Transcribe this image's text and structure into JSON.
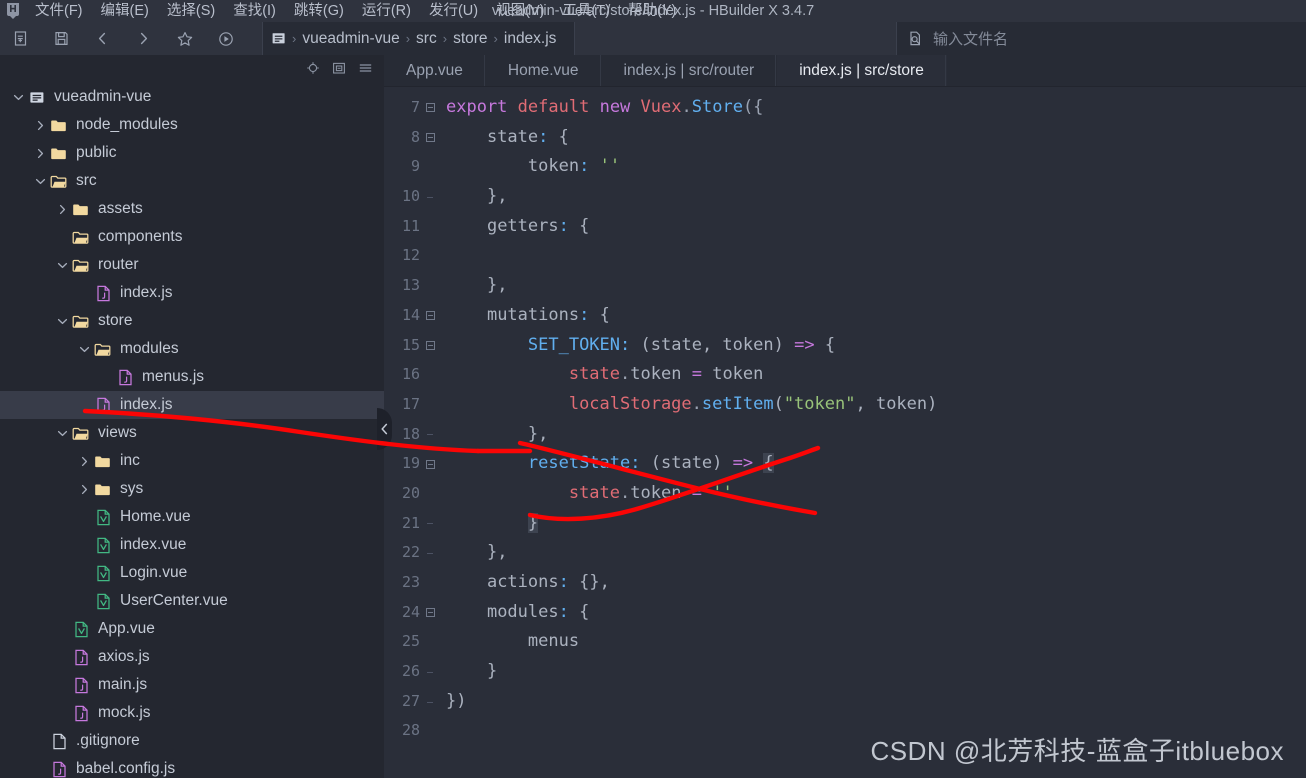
{
  "window": {
    "title": "vueadmin-vue/src/store/index.js - HBuilder X 3.4.7",
    "app_icon": "hbuilder-logo-icon"
  },
  "menubar": {
    "items": [
      {
        "label": "文件(F)"
      },
      {
        "label": "编辑(E)"
      },
      {
        "label": "选择(S)"
      },
      {
        "label": "查找(I)"
      },
      {
        "label": "跳转(G)"
      },
      {
        "label": "运行(R)"
      },
      {
        "label": "发行(U)"
      },
      {
        "label": "视图(V)"
      },
      {
        "label": "工具(T)"
      },
      {
        "label": "帮助(Y)"
      }
    ]
  },
  "toolbar": {
    "buttons": [
      {
        "name": "new-file-icon"
      },
      {
        "name": "save-icon"
      },
      {
        "name": "back-icon"
      },
      {
        "name": "forward-icon"
      },
      {
        "name": "favorite-star-icon"
      },
      {
        "name": "run-icon"
      }
    ]
  },
  "breadcrumb": {
    "icon": "project-folder-icon",
    "items": [
      "vueadmin-vue",
      "src",
      "store",
      "index.js"
    ],
    "separator": "›"
  },
  "filename_search": {
    "icon": "file-search-icon",
    "placeholder": "输入文件名",
    "value": ""
  },
  "sidebar": {
    "header_buttons": [
      {
        "name": "locate-file-icon"
      },
      {
        "name": "collapse-all-icon"
      },
      {
        "name": "sidebar-menu-icon"
      }
    ],
    "tree": [
      {
        "label": "vueadmin-vue",
        "depth": 0,
        "icon": "project-icon",
        "twisty": "down",
        "selected": false
      },
      {
        "label": "node_modules",
        "depth": 1,
        "icon": "folder-closed",
        "twisty": "right",
        "selected": false
      },
      {
        "label": "public",
        "depth": 1,
        "icon": "folder-closed",
        "twisty": "right",
        "selected": false
      },
      {
        "label": "src",
        "depth": 1,
        "icon": "folder-open",
        "twisty": "down",
        "selected": false
      },
      {
        "label": "assets",
        "depth": 2,
        "icon": "folder-closed",
        "twisty": "right",
        "selected": false
      },
      {
        "label": "components",
        "depth": 2,
        "icon": "folder-open",
        "twisty": "none",
        "selected": false
      },
      {
        "label": "router",
        "depth": 2,
        "icon": "folder-open",
        "twisty": "down",
        "selected": false
      },
      {
        "label": "index.js",
        "depth": 3,
        "icon": "js-file",
        "twisty": "none",
        "selected": false
      },
      {
        "label": "store",
        "depth": 2,
        "icon": "folder-open",
        "twisty": "down",
        "selected": false
      },
      {
        "label": "modules",
        "depth": 3,
        "icon": "folder-open",
        "twisty": "down",
        "selected": false
      },
      {
        "label": "menus.js",
        "depth": 4,
        "icon": "js-file",
        "twisty": "none",
        "selected": false
      },
      {
        "label": "index.js",
        "depth": 3,
        "icon": "js-file",
        "twisty": "none",
        "selected": true
      },
      {
        "label": "views",
        "depth": 2,
        "icon": "folder-open",
        "twisty": "down",
        "selected": false
      },
      {
        "label": "inc",
        "depth": 3,
        "icon": "folder-closed",
        "twisty": "right",
        "selected": false
      },
      {
        "label": "sys",
        "depth": 3,
        "icon": "folder-closed",
        "twisty": "right",
        "selected": false
      },
      {
        "label": "Home.vue",
        "depth": 3,
        "icon": "vue-file",
        "twisty": "none",
        "selected": false
      },
      {
        "label": "index.vue",
        "depth": 3,
        "icon": "vue-file",
        "twisty": "none",
        "selected": false
      },
      {
        "label": "Login.vue",
        "depth": 3,
        "icon": "vue-file",
        "twisty": "none",
        "selected": false
      },
      {
        "label": "UserCenter.vue",
        "depth": 3,
        "icon": "vue-file",
        "twisty": "none",
        "selected": false
      },
      {
        "label": "App.vue",
        "depth": 2,
        "icon": "vue-file",
        "twisty": "none",
        "selected": false
      },
      {
        "label": "axios.js",
        "depth": 2,
        "icon": "js-file",
        "twisty": "none",
        "selected": false
      },
      {
        "label": "main.js",
        "depth": 2,
        "icon": "js-file",
        "twisty": "none",
        "selected": false
      },
      {
        "label": "mock.js",
        "depth": 2,
        "icon": "js-file",
        "twisty": "none",
        "selected": false
      },
      {
        "label": ".gitignore",
        "depth": 1,
        "icon": "plain-file",
        "twisty": "none",
        "selected": false
      },
      {
        "label": "babel.config.js",
        "depth": 1,
        "icon": "js-file",
        "twisty": "none",
        "selected": false
      }
    ]
  },
  "tabs": [
    {
      "label": "App.vue",
      "active": false
    },
    {
      "label": "Home.vue",
      "active": false
    },
    {
      "label": "index.js | src/router",
      "active": false
    },
    {
      "label": "index.js | src/store",
      "active": true
    }
  ],
  "editor": {
    "first_line": 7,
    "lines": [
      {
        "num": 7,
        "fold": "box",
        "tokens": [
          {
            "t": "export",
            "c": "t-kw"
          },
          {
            "t": " ",
            "c": "t-plain"
          },
          {
            "t": "default",
            "c": "t-var"
          },
          {
            "t": " ",
            "c": "t-plain"
          },
          {
            "t": "new",
            "c": "t-kw"
          },
          {
            "t": " ",
            "c": "t-plain"
          },
          {
            "t": "Vuex",
            "c": "t-var"
          },
          {
            "t": ".",
            "c": "t-punc"
          },
          {
            "t": "Store",
            "c": "t-fn"
          },
          {
            "t": "({",
            "c": "t-punc"
          }
        ]
      },
      {
        "num": 8,
        "fold": "box",
        "tokens": [
          {
            "t": "    ",
            "c": "t-plain"
          },
          {
            "t": "state",
            "c": "t-plain"
          },
          {
            "t": ":",
            "c": "t-prop"
          },
          {
            "t": " {",
            "c": "t-plain"
          }
        ]
      },
      {
        "num": 9,
        "fold": "tick",
        "tokens": [
          {
            "t": "        ",
            "c": "t-plain"
          },
          {
            "t": "token",
            "c": "t-plain"
          },
          {
            "t": ":",
            "c": "t-prop"
          },
          {
            "t": " ",
            "c": "t-plain"
          },
          {
            "t": "''",
            "c": "t-str"
          }
        ]
      },
      {
        "num": 10,
        "fold": "end",
        "tokens": [
          {
            "t": "    ",
            "c": "t-plain"
          },
          {
            "t": "},",
            "c": "t-plain"
          }
        ]
      },
      {
        "num": 11,
        "fold": "tick",
        "tokens": [
          {
            "t": "    ",
            "c": "t-plain"
          },
          {
            "t": "getters",
            "c": "t-plain"
          },
          {
            "t": ":",
            "c": "t-prop"
          },
          {
            "t": " {",
            "c": "t-plain"
          }
        ]
      },
      {
        "num": 12,
        "fold": "tick",
        "tokens": []
      },
      {
        "num": 13,
        "fold": "tick",
        "tokens": [
          {
            "t": "    ",
            "c": "t-plain"
          },
          {
            "t": "},",
            "c": "t-plain"
          }
        ]
      },
      {
        "num": 14,
        "fold": "box",
        "tokens": [
          {
            "t": "    ",
            "c": "t-plain"
          },
          {
            "t": "mutations",
            "c": "t-plain"
          },
          {
            "t": ":",
            "c": "t-prop"
          },
          {
            "t": " {",
            "c": "t-plain"
          }
        ]
      },
      {
        "num": 15,
        "fold": "box",
        "tokens": [
          {
            "t": "        ",
            "c": "t-plain"
          },
          {
            "t": "SET_TOKEN",
            "c": "t-fn"
          },
          {
            "t": ":",
            "c": "t-prop"
          },
          {
            "t": " (",
            "c": "t-plain"
          },
          {
            "t": "state",
            "c": "t-plain"
          },
          {
            "t": ", ",
            "c": "t-plain"
          },
          {
            "t": "token",
            "c": "t-plain"
          },
          {
            "t": ") ",
            "c": "t-plain"
          },
          {
            "t": "=>",
            "c": "t-arrow"
          },
          {
            "t": " {",
            "c": "t-plain"
          }
        ]
      },
      {
        "num": 16,
        "fold": "tick",
        "tokens": [
          {
            "t": "            ",
            "c": "t-plain"
          },
          {
            "t": "state",
            "c": "t-var"
          },
          {
            "t": ".",
            "c": "t-punc"
          },
          {
            "t": "token",
            "c": "t-plain"
          },
          {
            "t": " ",
            "c": "t-plain"
          },
          {
            "t": "=",
            "c": "t-op"
          },
          {
            "t": " ",
            "c": "t-plain"
          },
          {
            "t": "token",
            "c": "t-plain"
          }
        ]
      },
      {
        "num": 17,
        "fold": "tick",
        "tokens": [
          {
            "t": "            ",
            "c": "t-plain"
          },
          {
            "t": "localStorage",
            "c": "t-var"
          },
          {
            "t": ".",
            "c": "t-punc"
          },
          {
            "t": "setItem",
            "c": "t-fn"
          },
          {
            "t": "(",
            "c": "t-plain"
          },
          {
            "t": "\"token\"",
            "c": "t-str"
          },
          {
            "t": ", ",
            "c": "t-plain"
          },
          {
            "t": "token",
            "c": "t-plain"
          },
          {
            "t": ")",
            "c": "t-plain"
          }
        ]
      },
      {
        "num": 18,
        "fold": "end",
        "tokens": [
          {
            "t": "        ",
            "c": "t-plain"
          },
          {
            "t": "},",
            "c": "t-plain"
          }
        ]
      },
      {
        "num": 19,
        "fold": "box",
        "tokens": [
          {
            "t": "        ",
            "c": "t-plain"
          },
          {
            "t": "resetState",
            "c": "t-fn"
          },
          {
            "t": ":",
            "c": "t-prop"
          },
          {
            "t": " (",
            "c": "t-plain"
          },
          {
            "t": "state",
            "c": "t-plain"
          },
          {
            "t": ") ",
            "c": "t-plain"
          },
          {
            "t": "=>",
            "c": "t-arrow"
          },
          {
            "t": " ",
            "c": "t-plain"
          },
          {
            "t": "{",
            "c": "t-plain brace-hl"
          }
        ]
      },
      {
        "num": 20,
        "fold": "tick",
        "tokens": [
          {
            "t": "            ",
            "c": "t-plain"
          },
          {
            "t": "state",
            "c": "t-var"
          },
          {
            "t": ".",
            "c": "t-punc"
          },
          {
            "t": "token",
            "c": "t-plain"
          },
          {
            "t": " ",
            "c": "t-plain"
          },
          {
            "t": "=",
            "c": "t-op"
          },
          {
            "t": " ",
            "c": "t-plain"
          },
          {
            "t": "''",
            "c": "t-str"
          }
        ]
      },
      {
        "num": 21,
        "fold": "end",
        "tokens": [
          {
            "t": "        ",
            "c": "t-plain"
          },
          {
            "t": "}",
            "c": "t-plain brace-hl"
          }
        ]
      },
      {
        "num": 22,
        "fold": "end",
        "tokens": [
          {
            "t": "    ",
            "c": "t-plain"
          },
          {
            "t": "},",
            "c": "t-plain"
          }
        ]
      },
      {
        "num": 23,
        "fold": "tick",
        "tokens": [
          {
            "t": "    ",
            "c": "t-plain"
          },
          {
            "t": "actions",
            "c": "t-plain"
          },
          {
            "t": ":",
            "c": "t-prop"
          },
          {
            "t": " {},",
            "c": "t-plain"
          }
        ]
      },
      {
        "num": 24,
        "fold": "box",
        "tokens": [
          {
            "t": "    ",
            "c": "t-plain"
          },
          {
            "t": "modules",
            "c": "t-plain"
          },
          {
            "t": ":",
            "c": "t-prop"
          },
          {
            "t": " {",
            "c": "t-plain"
          }
        ]
      },
      {
        "num": 25,
        "fold": "tick",
        "tokens": [
          {
            "t": "        ",
            "c": "t-plain"
          },
          {
            "t": "menus",
            "c": "t-plain"
          }
        ]
      },
      {
        "num": 26,
        "fold": "end",
        "tokens": [
          {
            "t": "    ",
            "c": "t-plain"
          },
          {
            "t": "}",
            "c": "t-plain"
          }
        ]
      },
      {
        "num": 27,
        "fold": "end",
        "tokens": [
          {
            "t": "})",
            "c": "t-plain"
          }
        ]
      },
      {
        "num": 28,
        "fold": "none",
        "tokens": []
      }
    ]
  },
  "collapse_handle": {
    "icon": "chevron-left-icon"
  },
  "annotation": {
    "color": "#fb0505",
    "description": "hand-drawn red strokes crossing out resetState mutation"
  },
  "watermark": {
    "text": "CSDN @北芳科技-蓝盒子itbluebox"
  },
  "theme": {
    "editor_bg": "#2a2e39",
    "sidebar_bg": "#242730",
    "chrome_bg": "#2f333e",
    "tabbar_bg": "#272b35",
    "selection_bg": "#383c49",
    "text": "#c5cbd6",
    "muted_text": "#8b93a2",
    "folder_color": "#f2d9a0",
    "js_icon_color": "#c678dd",
    "vue_icon_color": "#42b883",
    "accent_keyword": "#c678dd",
    "accent_string": "#98c379",
    "accent_function": "#61afef",
    "accent_variable": "#e06c75"
  }
}
